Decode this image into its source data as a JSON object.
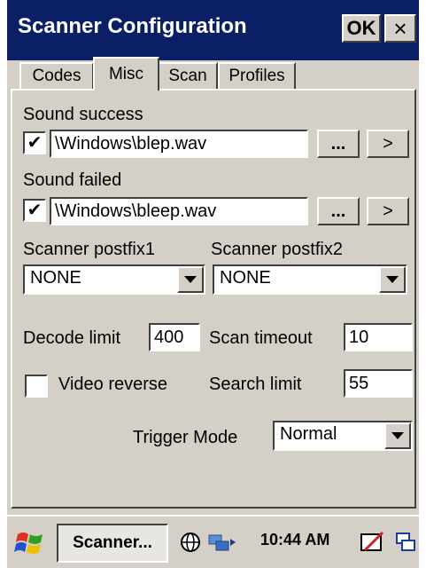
{
  "window": {
    "title": "Scanner Configuration",
    "ok_label": "OK",
    "close_label": "×"
  },
  "tabs": [
    {
      "label": "Codes"
    },
    {
      "label": "Misc",
      "active": true
    },
    {
      "label": "Scan"
    },
    {
      "label": "Profiles"
    }
  ],
  "misc": {
    "sound_success": {
      "label": "Sound success",
      "checked": true,
      "check_glyph": "✔",
      "path": "\\Windows\\blep.wav",
      "browse_label": "...",
      "play_label": ">"
    },
    "sound_failed": {
      "label": "Sound failed",
      "checked": true,
      "check_glyph": "✔",
      "path": "\\Windows\\bleep.wav",
      "browse_label": "...",
      "play_label": ">"
    },
    "postfix1": {
      "label": "Scanner postfix1",
      "value": "NONE"
    },
    "postfix2": {
      "label": "Scanner postfix2",
      "value": "NONE"
    },
    "decode_limit": {
      "label": "Decode limit",
      "value": "400"
    },
    "scan_timeout": {
      "label": "Scan timeout",
      "value": "10"
    },
    "video_reverse": {
      "label": "Video reverse",
      "checked": false
    },
    "search_limit": {
      "label": "Search limit",
      "value": "55"
    },
    "trigger_mode": {
      "label": "Trigger Mode",
      "value": "Normal"
    }
  },
  "taskbar": {
    "task_label": "Scanner...",
    "clock": "10:44 AM"
  }
}
